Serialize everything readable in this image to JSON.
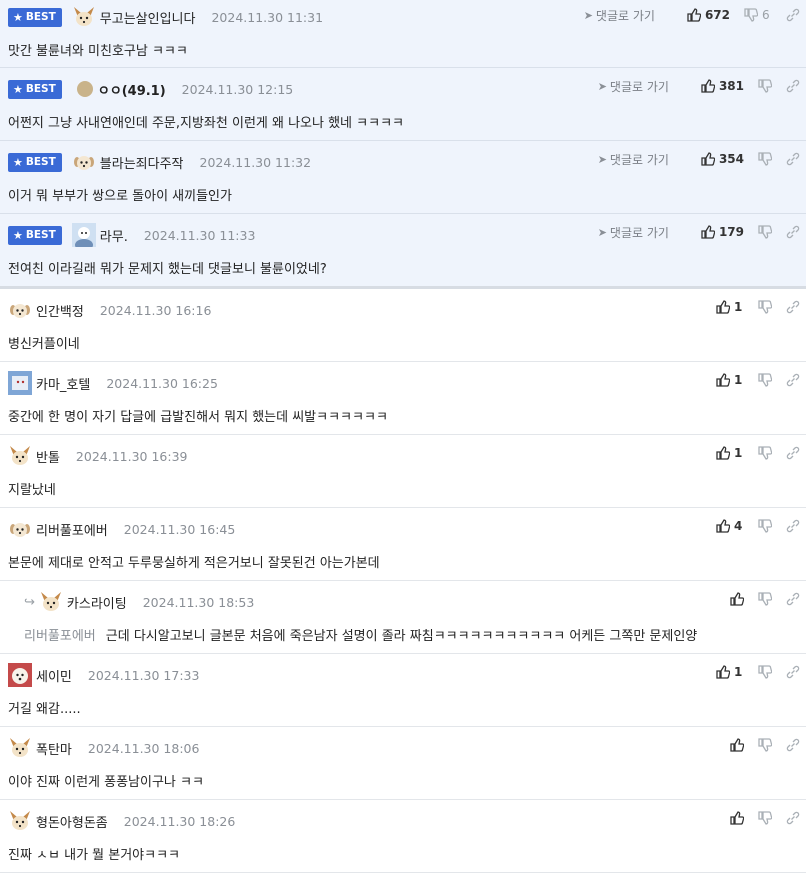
{
  "comments": [
    {
      "best": true,
      "badge": "BEST",
      "name": "무고는살인입니다",
      "date": "2024.11.30 11:31",
      "text": "맛간 불륜녀와 미친호구남 ㅋㅋㅋ",
      "goto": "댓글로 가기",
      "likes": "672",
      "dislikes": "6",
      "avatar": "fox"
    },
    {
      "best": true,
      "badge": "BEST",
      "name": "ㅇㅇ(49.1)",
      "date": "2024.11.30 12:15",
      "text": "어쩐지 그냥 사내연애인데 주문,지방좌천 이런게 왜 나오나 했네 ㅋㅋㅋㅋ",
      "goto": "댓글로 가기",
      "likes": "381",
      "dislikes": "",
      "avatar": "dot"
    },
    {
      "best": true,
      "badge": "BEST",
      "name": "블라는죄다주작",
      "date": "2024.11.30 11:32",
      "text": "이거 뭐 부부가 쌍으로 돌아이 새끼들인가",
      "goto": "댓글로 가기",
      "likes": "354",
      "dislikes": "",
      "avatar": "puppy"
    },
    {
      "best": true,
      "badge": "BEST",
      "name": "라무.",
      "date": "2024.11.30 11:33",
      "text": "전여친 이라길래 뭐가 문제지 했는데 댓글보니 불륜이었네?",
      "goto": "댓글로 가기",
      "likes": "179",
      "dislikes": "",
      "avatar": "photo"
    },
    {
      "best": false,
      "name": "인간백정",
      "date": "2024.11.30 16:16",
      "text": "병신커플이네",
      "likes": "1",
      "avatar": "puppy"
    },
    {
      "best": false,
      "name": "카마_호텔",
      "date": "2024.11.30 16:25",
      "text": "중간에 한 명이 자기 답글에 급발진해서 뭐지 했는데 씨발ㅋㅋㅋㅋㅋㅋ",
      "likes": "1",
      "avatar": "photo2"
    },
    {
      "best": false,
      "name": "반톨",
      "date": "2024.11.30 16:39",
      "text": "지랄났네",
      "likes": "1",
      "avatar": "fox"
    },
    {
      "best": false,
      "name": "리버풀포에버",
      "date": "2024.11.30 16:45",
      "text": "본문에 제대로 안적고 두루뭉실하게 적은거보니 잘못된건 아는가본데",
      "likes": "4",
      "avatar": "puppy"
    },
    {
      "best": false,
      "reply": true,
      "name": "카스라이팅",
      "date": "2024.11.30 18:53",
      "mention": "리버풀포에버",
      "text": "근데 다시알고보니 글본문 처음에 죽은남자 설명이 졸라 짜침ㅋㅋㅋㅋㅋㅋㅋㅋㅋㅋㅋ 어케든 그쪽만 문제인양",
      "likes": "",
      "avatar": "fox"
    },
    {
      "best": false,
      "name": "세이민",
      "date": "2024.11.30 17:33",
      "text": "거길 왜감.....",
      "likes": "1",
      "avatar": "dog"
    },
    {
      "best": false,
      "name": "폭탄마",
      "date": "2024.11.30 18:06",
      "text": "이야 진짜 이런게 퐁퐁남이구나 ㅋㅋ",
      "likes": "",
      "avatar": "fox"
    },
    {
      "best": false,
      "name": "형돈아형돈좀",
      "date": "2024.11.30 18:26",
      "text": "진짜 ㅅㅂ 내가 뭘 본거야ㅋㅋㅋ",
      "likes": "",
      "avatar": "fox"
    }
  ],
  "colors": {
    "badge": "#3a6ad6",
    "best_bg": "#eff4fc",
    "date": "#8a8f96"
  }
}
